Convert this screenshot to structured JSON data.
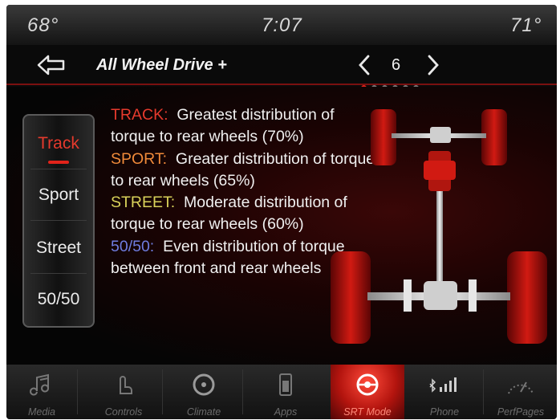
{
  "status": {
    "temp_left": "68°",
    "time": "7:07",
    "temp_right": "71°"
  },
  "header": {
    "title": "All Wheel Drive +",
    "page": "6"
  },
  "pagination": {
    "count": 6,
    "active": 0
  },
  "modes": {
    "items": [
      "Track",
      "Sport",
      "Street",
      "50/50"
    ],
    "selected": "Track"
  },
  "descriptions": {
    "track": {
      "key": "TRACK:",
      "text": "Greatest distribution of torque to rear wheels (70%)"
    },
    "sport": {
      "key": "SPORT:",
      "text": "Greater distribution of torque to rear wheels (65%)"
    },
    "street": {
      "key": "STREET:",
      "text": "Moderate distribution of torque to rear wheels (60%)"
    },
    "fifty": {
      "key": "50/50:",
      "text": "Even distribution of torque between front and rear wheels"
    }
  },
  "nav": {
    "items": [
      "Media",
      "Controls",
      "Climate",
      "Apps",
      "SRT Mode",
      "Phone",
      "PerfPages"
    ],
    "active": "SRT Mode"
  },
  "colors": {
    "accent": "#e2231a",
    "track": "#e63a2d",
    "sport": "#f08a3a",
    "street": "#d9d25a",
    "fifty": "#6f7de0"
  },
  "icons": [
    "back-arrow-icon",
    "chevron-left-icon",
    "chevron-right-icon",
    "music-note-icon",
    "touch-hand-icon",
    "climate-fan-icon",
    "apps-icon",
    "steering-wheel-icon",
    "bluetooth-signal-icon",
    "gauge-icon"
  ]
}
